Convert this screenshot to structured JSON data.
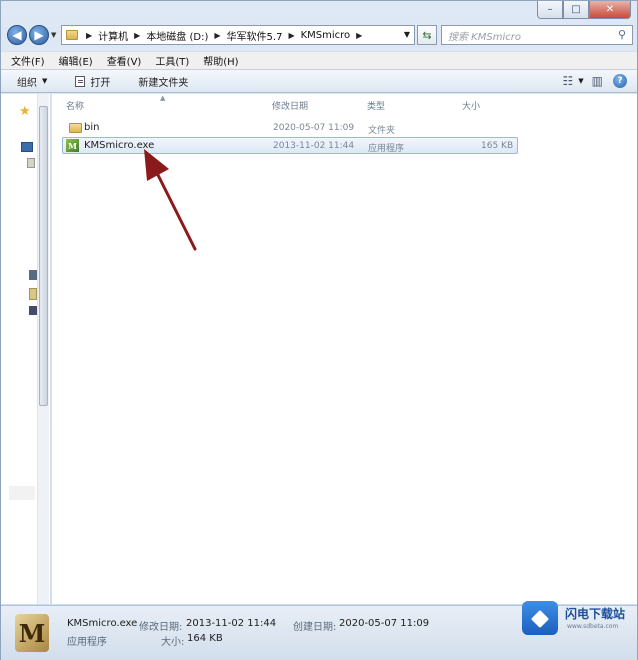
{
  "window": {
    "caption_min": "–",
    "caption_max": "□",
    "caption_close": "✕"
  },
  "address": {
    "crumbs": [
      "计算机",
      "本地磁盘 (D:)",
      "华军软件5.7",
      "KMSmicro"
    ],
    "search_placeholder": "搜索 KMSmicro"
  },
  "menu": {
    "items": [
      "文件(F)",
      "编辑(E)",
      "查看(V)",
      "工具(T)",
      "帮助(H)"
    ]
  },
  "toolbar": {
    "organize": "组织",
    "open": "打开",
    "new_folder": "新建文件夹"
  },
  "columns": {
    "name": "名称",
    "modified": "修改日期",
    "type": "类型",
    "size": "大小"
  },
  "files": [
    {
      "name": "bin",
      "modified": "2020-05-07 11:09",
      "type": "文件夹",
      "size": "",
      "icon": "folder-icon"
    },
    {
      "name": "KMSmicro.exe",
      "modified": "2013-11-02 11:44",
      "type": "应用程序",
      "size": "165 KB",
      "icon": "kmsmicro-app-icon",
      "selected": true
    }
  ],
  "details": {
    "filename": "KMSmicro.exe",
    "modified_label": "修改日期:",
    "modified_value": "2013-11-02 11:44",
    "created_label": "创建日期:",
    "created_value": "2020-05-07 11:09",
    "type": "应用程序",
    "size_label": "大小:",
    "size_value": "164 KB"
  },
  "watermark": {
    "title": "闪电下载站",
    "url": "www.sdbeta.com"
  },
  "colors": {
    "arrow": "#8b1a1a",
    "selection": "#dce8f6",
    "accent": "#1c4f9c"
  }
}
